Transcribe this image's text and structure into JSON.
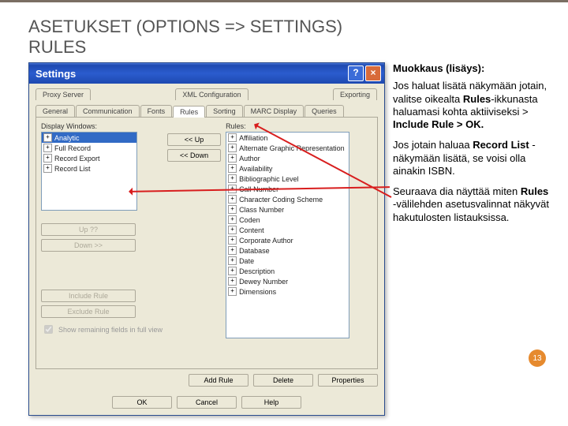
{
  "slide": {
    "title_line1": "ASETUKSET (OPTIONS => SETTINGS)",
    "title_line2": "RULES",
    "page_number": "13"
  },
  "dialog": {
    "title": "Settings",
    "close": "×",
    "help": "?",
    "tabs_row1": [
      "Proxy Server",
      "XML Configuration",
      "Exporting"
    ],
    "tabs_row2": [
      "General",
      "Communication",
      "Fonts",
      "Rules",
      "Sorting",
      "MARC Display",
      "Queries"
    ],
    "left_label": "Display Windows:",
    "right_label": "Rules:",
    "windows": [
      "Analytic",
      "Full Record",
      "Record Export",
      "Record List"
    ],
    "upup": "<< Up",
    "down_mid": "<< Down",
    "up_btn": "Up ??",
    "down_btn": "Down >>",
    "include": "Include Rule",
    "exclude": "Exclude Rule",
    "rules_list": [
      "Affiliation",
      "Alternate Graphic Representation",
      "Author",
      "Availability",
      "Bibliographic Level",
      "Call Number",
      "Character Coding Scheme",
      "Class Number",
      "Coden",
      "Content",
      "Corporate Author",
      "Database",
      "Date",
      "Description",
      "Dewey Number",
      "Dimensions"
    ],
    "check_label": "Show remaining fields in full view",
    "add_rule": "Add Rule",
    "delete": "Delete",
    "properties": "Properties",
    "ok": "OK",
    "cancel": "Cancel",
    "help_btn": "Help"
  },
  "notes": {
    "heading": "Muokkaus (lisäys):",
    "p1a": "Jos haluat lisätä näkymään jotain, valitse oikealta ",
    "p1b": "Rules",
    "p1c": "-ikkunasta haluamasi kohta aktiiviseksi > ",
    "p1d": "Include Rule > OK.",
    "p2a": "Jos jotain haluaa ",
    "p2b": "Record List",
    "p2c": " -näkymään lisätä, se voisi olla ainakin ISBN.",
    "p3a": "Seuraava dia näyttää miten ",
    "p3b": "Rules",
    "p3c": " -välilehden asetusvalinnat näkyvät hakutulosten listauksissa."
  }
}
